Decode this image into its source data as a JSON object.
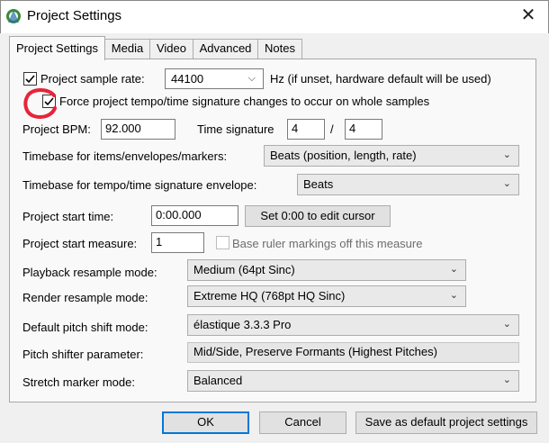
{
  "window": {
    "title": "Project Settings",
    "close_glyph": "✕"
  },
  "tabs": [
    {
      "label": "Project Settings",
      "active": true
    },
    {
      "label": "Media"
    },
    {
      "label": "Video"
    },
    {
      "label": "Advanced"
    },
    {
      "label": "Notes"
    }
  ],
  "sample_rate": {
    "label": "Project sample rate:",
    "value": "44100",
    "hint": "Hz (if unset, hardware default will be used)",
    "checked": true
  },
  "force_whole_samples": {
    "label": "Force project tempo/time signature changes to occur on whole samples",
    "checked": true
  },
  "bpm": {
    "label": "Project BPM:",
    "value": "92.000"
  },
  "time_signature": {
    "label": "Time signature",
    "numerator": "4",
    "slash": "/",
    "denominator": "4"
  },
  "timebase_items": {
    "label": "Timebase for items/envelopes/markers:",
    "value": "Beats (position, length, rate)"
  },
  "timebase_tempo": {
    "label": "Timebase for tempo/time signature envelope:",
    "value": "Beats"
  },
  "start_time": {
    "label": "Project start time:",
    "value": "0:00.000",
    "button": "Set 0:00 to edit cursor"
  },
  "start_measure": {
    "label": "Project start measure:",
    "value": "1",
    "base_ruler_label": "Base ruler markings off this measure"
  },
  "playback_resample": {
    "label": "Playback resample mode:",
    "value": "Medium (64pt Sinc)"
  },
  "render_resample": {
    "label": "Render resample mode:",
    "value": "Extreme HQ (768pt HQ Sinc)"
  },
  "pitch_shift": {
    "label": "Default pitch shift mode:",
    "value": "élastique 3.3.3 Pro"
  },
  "pitch_param": {
    "label": "Pitch shifter parameter:",
    "value": "Mid/Side, Preserve Formants (Highest Pitches)"
  },
  "stretch_marker": {
    "label": "Stretch marker mode:",
    "value": "Balanced"
  },
  "footer": {
    "ok": "OK",
    "cancel": "Cancel",
    "save_default": "Save as default project settings"
  },
  "icons": {
    "app": "reaper-logo-icon",
    "dropdown": "chevron-down-icon",
    "check": "check-icon"
  },
  "colors": {
    "accent": "#0078d7",
    "annotation": "#e8233a"
  }
}
